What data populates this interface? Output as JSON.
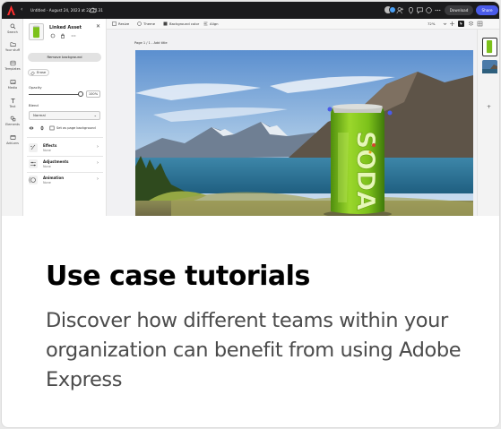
{
  "app": {
    "document_title": "Untitled - August 24, 2023 at 22.17.31",
    "download_label": "Download",
    "share_label": "Share"
  },
  "rail": {
    "items": [
      {
        "label": "Search",
        "icon": "search-icon"
      },
      {
        "label": "Your stuff",
        "icon": "folder-icon"
      },
      {
        "label": "Templates",
        "icon": "templates-icon"
      },
      {
        "label": "Media",
        "icon": "media-icon"
      },
      {
        "label": "Text",
        "icon": "text-icon"
      },
      {
        "label": "Elements",
        "icon": "elements-icon"
      },
      {
        "label": "Add-ons",
        "icon": "addons-icon"
      }
    ]
  },
  "panel": {
    "title": "Linked Asset",
    "remove_background_label": "Remove background",
    "erase_label": "Erase",
    "opacity_label": "Opacity",
    "opacity_value": "100%",
    "opacity_level": 1.0,
    "blend_label": "Blend",
    "blend_value": "Normal",
    "set_page_background_label": "Set as page background",
    "sections": [
      {
        "title": "Effects",
        "subtitle": "None",
        "icon": "effects-icon"
      },
      {
        "title": "Adjustments",
        "subtitle": "None",
        "icon": "adjustments-icon"
      },
      {
        "title": "Animation",
        "subtitle": "None",
        "icon": "animation-icon"
      }
    ]
  },
  "toolbar": {
    "resize_label": "Resize",
    "theme_label": "Theme",
    "background_color_label": "Background color",
    "align_label": "Align",
    "zoom_value": "72%"
  },
  "canvas": {
    "page_label": "Page 1 / 1 - Add title",
    "can_text": "SODA"
  },
  "pages_panel": {
    "add_label": "Add"
  },
  "card": {
    "heading": "Use case tutorials",
    "description": "Discover how different teams within your organization can benefit from using Adobe Express"
  },
  "colors": {
    "share_button": "#4a5bea",
    "topbar": "#1b1b1d",
    "heading": "#000000",
    "description": "#4b4b4b",
    "can_green": "#7cc11a"
  }
}
